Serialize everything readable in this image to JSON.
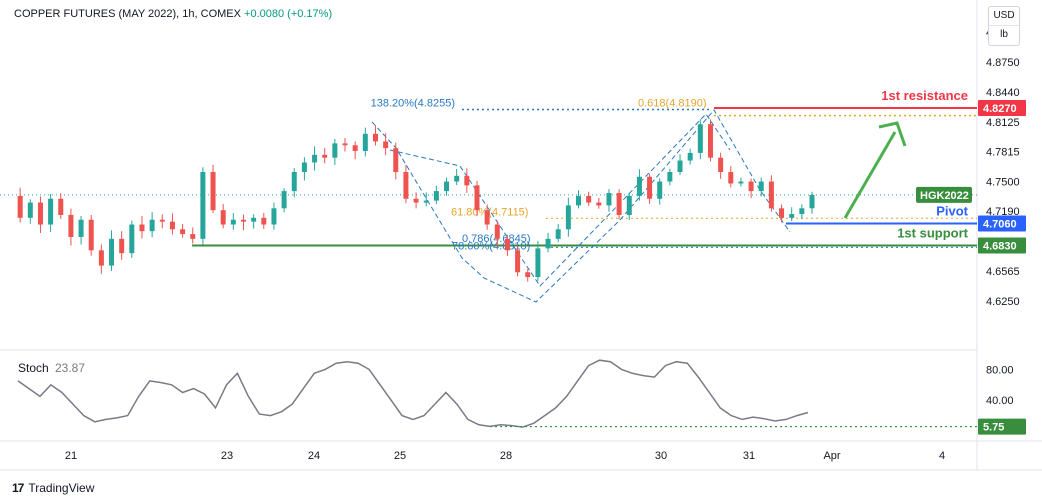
{
  "header": {
    "title": "COPPER FUTURES (MAY 2022), 1h, COMEX",
    "change": "+0.0080 (+0.17%)"
  },
  "currency": {
    "unit": "USD",
    "sub": "lb"
  },
  "colors": {
    "up": "#26a69a",
    "down": "#ef5350",
    "resistance": "#f23645",
    "pivot": "#2962ff",
    "support": "#388e3c",
    "fib_blue": "#2979c4",
    "fib_gold": "#e6a52b",
    "stoch": "#787b86",
    "arrow": "#4caf50"
  },
  "chart_data": {
    "type": "candlestick",
    "symbol": "HGK2022",
    "price_axis": {
      "ticks": [
        "4.9065",
        "4.8750",
        "4.8440",
        "4.8125",
        "4.7815",
        "4.7500",
        "4.7190",
        "4.6565",
        "4.6250"
      ],
      "ylim": [
        4.605,
        4.915
      ]
    },
    "time_axis": {
      "ticks": [
        "21",
        "23",
        "24",
        "25",
        "28",
        "30",
        "31",
        "Apr",
        "4"
      ]
    },
    "levels": [
      {
        "label": "1st resistance",
        "value": 4.827,
        "price_tag": "4.8270"
      },
      {
        "label": "Pivot",
        "value": 4.706,
        "price_tag": "4.7060"
      },
      {
        "label": "1st support",
        "value": 4.683,
        "price_tag": "4.6830"
      }
    ],
    "last_price_tag": "HGK2022",
    "last_price": 4.736,
    "fib_labels": [
      {
        "text": "138.20%(4.8255)",
        "value": 4.8255
      },
      {
        "text": "0.618(4.8190)",
        "value": 4.819
      },
      {
        "text": "61.80%(4.7115)",
        "value": 4.7115
      },
      {
        "text": "0.786(4.6845)",
        "value": 4.6845
      },
      {
        "text": "78.60%(4.6810)",
        "value": 4.681
      }
    ],
    "path_close": [
      4.735,
      4.712,
      4.728,
      4.705,
      4.732,
      4.715,
      4.692,
      4.71,
      4.678,
      4.662,
      4.69,
      4.675,
      4.705,
      4.698,
      4.71,
      4.708,
      4.7,
      4.695,
      4.69,
      4.76,
      4.72,
      4.705,
      4.71,
      4.708,
      4.712,
      4.705,
      4.722,
      4.74,
      4.76,
      4.77,
      4.778,
      4.775,
      4.79,
      4.788,
      4.782,
      4.8,
      4.792,
      4.785,
      4.76,
      4.732,
      4.728,
      4.73,
      4.74,
      4.75,
      4.756,
      4.746,
      4.72,
      4.705,
      4.69,
      4.678,
      4.655,
      4.65,
      4.68,
      4.69,
      4.7,
      4.725,
      4.735,
      4.728,
      4.725,
      4.738,
      4.715,
      4.735,
      4.755,
      4.732,
      4.75,
      4.76,
      4.772,
      4.78,
      4.81,
      4.775,
      4.76,
      4.748,
      4.75,
      4.74,
      4.75,
      4.722,
      4.712,
      4.716,
      4.722,
      4.736
    ],
    "stochastic": {
      "label": "Stoch",
      "value": "23.87",
      "axis_ticks": [
        "80.00",
        "40.00"
      ],
      "ylim": [
        0,
        100
      ],
      "level_tag": "5.75",
      "level_value": 5.75,
      "path": [
        65,
        55,
        45,
        60,
        50,
        35,
        20,
        12,
        15,
        17,
        20,
        45,
        65,
        63,
        60,
        50,
        55,
        48,
        30,
        60,
        75,
        45,
        22,
        20,
        25,
        35,
        55,
        75,
        80,
        88,
        90,
        88,
        80,
        60,
        40,
        20,
        15,
        20,
        35,
        50,
        35,
        15,
        8,
        6,
        8,
        7,
        5,
        10,
        20,
        30,
        45,
        65,
        85,
        92,
        90,
        80,
        75,
        72,
        70,
        85,
        90,
        88,
        70,
        50,
        30,
        20,
        15,
        18,
        16,
        13,
        15,
        20,
        24
      ]
    }
  },
  "footer": {
    "brand": "TradingView"
  }
}
